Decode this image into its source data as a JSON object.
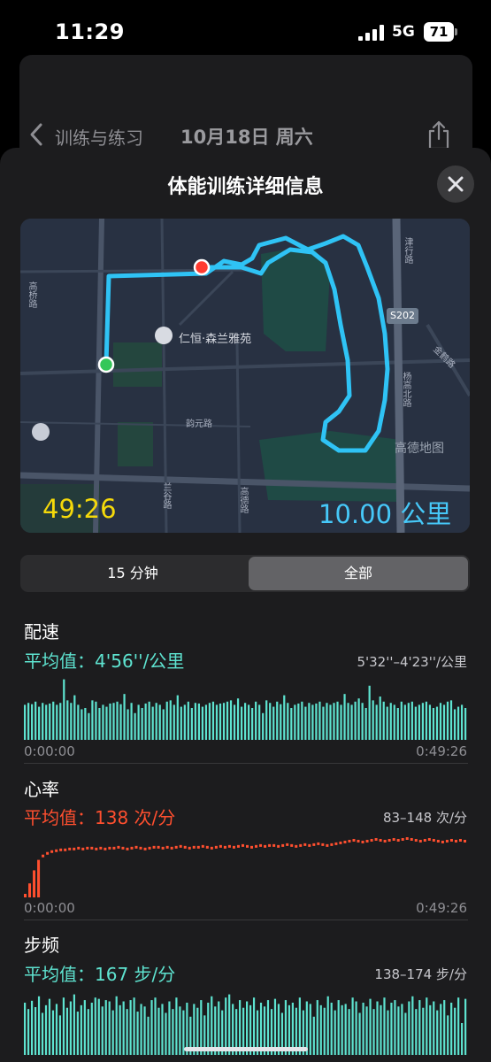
{
  "status_bar": {
    "time": "11:29",
    "network": "5G",
    "battery": "71"
  },
  "header": {
    "back_label": "训练与练习",
    "date_title": "10月18日 周六",
    "share_icon": "share-icon"
  },
  "sheet": {
    "title": "体能训练详细信息",
    "close_icon": "close-icon"
  },
  "map": {
    "duration": "49:26",
    "distance": "10.00 公里",
    "place_label": "仁恒·森兰雅苑",
    "road_labels": [
      "高桥路",
      "韵元路",
      "兰谷路",
      "高德路",
      "S202",
      "杨高北路",
      "津行路",
      "金鹤路"
    ],
    "watermark": "高德地图",
    "route_color": "#2fc3f5",
    "start_color": "#34c759",
    "end_color": "#ff3b30"
  },
  "segments": {
    "left": "15 分钟",
    "right": "全部",
    "selected": "全部"
  },
  "metrics": {
    "pace": {
      "title": "配速",
      "average": "平均值：4'56''/公里",
      "range": "5'32''–4'23''/公里",
      "start": "0:00:00",
      "end": "0:49:26",
      "color": "#5ee3d0"
    },
    "heart_rate": {
      "title": "心率",
      "average": "平均值：138 次/分",
      "range": "83–148 次/分",
      "start": "0:00:00",
      "end": "0:49:26",
      "color": "#ff4f2f"
    },
    "cadence": {
      "title": "步频",
      "average": "平均值：167 步/分",
      "range": "138–174 步/分",
      "start": "0:00:00",
      "end": "0:49:26",
      "color": "#5ee3d0"
    }
  },
  "chart_data": [
    {
      "type": "bar",
      "name": "配速",
      "x_range": [
        "0:00:00",
        "0:49:26"
      ],
      "values": [
        0.55,
        0.58,
        0.56,
        0.6,
        0.52,
        0.58,
        0.55,
        0.57,
        0.6,
        0.55,
        0.58,
        0.95,
        0.62,
        0.58,
        0.7,
        0.55,
        0.48,
        0.5,
        0.42,
        0.62,
        0.6,
        0.5,
        0.55,
        0.52,
        0.57,
        0.58,
        0.6,
        0.56,
        0.72,
        0.48,
        0.58,
        0.42,
        0.55,
        0.5,
        0.57,
        0.6,
        0.52,
        0.58,
        0.55,
        0.48,
        0.6,
        0.62,
        0.55,
        0.7,
        0.52,
        0.55,
        0.6,
        0.5,
        0.58,
        0.57,
        0.52,
        0.55,
        0.58,
        0.6,
        0.55,
        0.57,
        0.58,
        0.6,
        0.62,
        0.55,
        0.65,
        0.52,
        0.58,
        0.55,
        0.5,
        0.6,
        0.55,
        0.42,
        0.62,
        0.58,
        0.52,
        0.6,
        0.56,
        0.7,
        0.58,
        0.5,
        0.55,
        0.57,
        0.6,
        0.52,
        0.58,
        0.55,
        0.57,
        0.6,
        0.52,
        0.58,
        0.55,
        0.58,
        0.6,
        0.55,
        0.72,
        0.58,
        0.55,
        0.6,
        0.65,
        0.58,
        0.5,
        0.85,
        0.62,
        0.55,
        0.68,
        0.6,
        0.52,
        0.58,
        0.55,
        0.5,
        0.6,
        0.55,
        0.58,
        0.6,
        0.52,
        0.55,
        0.58,
        0.6,
        0.55,
        0.5,
        0.52,
        0.58,
        0.55,
        0.6,
        0.62,
        0.48,
        0.52,
        0.55,
        0.5
      ]
    },
    {
      "type": "line",
      "name": "心率",
      "x_range": [
        "0:00:00",
        "0:49:26"
      ],
      "y_range": [
        83,
        148
      ],
      "values": [
        83,
        95,
        110,
        122,
        128,
        131,
        133,
        134,
        135,
        135,
        136,
        136,
        137,
        136,
        137,
        137,
        136,
        137,
        136,
        137,
        137,
        138,
        137,
        136,
        137,
        138,
        137,
        136,
        137,
        138,
        138,
        137,
        138,
        137,
        138,
        139,
        138,
        137,
        138,
        138,
        139,
        138,
        137,
        138,
        139,
        138,
        139,
        138,
        139,
        140,
        139,
        138,
        139,
        140,
        139,
        140,
        140,
        139,
        140,
        141,
        140,
        139,
        140,
        141,
        140,
        141,
        142,
        141,
        140,
        141,
        142,
        143,
        144,
        145,
        146,
        145,
        144,
        145,
        146,
        147,
        146,
        145,
        146,
        147,
        146,
        147,
        148,
        147,
        146,
        145,
        146,
        147,
        146,
        145,
        144,
        145,
        146,
        145,
        146,
        145
      ]
    },
    {
      "type": "bar",
      "name": "步频",
      "x_range": [
        "0:00:00",
        "0:49:26"
      ],
      "y_range": [
        138,
        174
      ],
      "values": [
        0.82,
        0.72,
        0.85,
        0.75,
        0.92,
        0.66,
        0.78,
        0.88,
        0.7,
        0.8,
        0.62,
        0.9,
        0.74,
        0.84,
        0.95,
        0.68,
        0.78,
        0.86,
        0.72,
        0.82,
        0.9,
        0.88,
        0.76,
        0.86,
        0.84,
        0.7,
        0.92,
        0.78,
        0.84,
        0.72,
        0.86,
        0.9,
        0.68,
        0.8,
        0.76,
        0.6,
        0.86,
        0.9,
        0.74,
        0.8,
        0.66,
        0.84,
        0.72,
        0.9,
        0.76,
        0.7,
        0.82,
        0.6,
        0.8,
        0.74,
        0.86,
        0.62,
        0.82,
        0.92,
        0.76,
        0.84,
        0.7,
        0.9,
        0.95,
        0.8,
        0.72,
        0.86,
        0.74,
        0.84,
        0.78,
        0.9,
        0.7,
        0.82,
        0.76,
        0.86,
        0.72,
        0.88,
        0.8,
        0.66,
        0.86,
        0.78,
        0.82,
        0.74,
        0.9,
        0.7,
        0.84,
        0.8,
        0.6,
        0.86,
        0.78,
        0.74,
        0.92,
        0.82,
        0.7,
        0.86,
        0.78,
        0.8,
        0.72,
        0.9,
        0.84,
        0.66,
        0.82,
        0.76,
        0.88,
        0.72,
        0.84,
        0.78,
        0.9,
        0.7,
        0.82,
        0.86,
        0.76,
        0.8,
        0.66,
        0.84,
        0.92,
        0.72,
        0.86,
        0.74,
        0.9,
        0.78,
        0.84,
        0.7,
        0.8,
        0.86,
        0.62,
        0.82,
        0.74,
        0.9,
        0.5,
        0.88
      ]
    }
  ]
}
